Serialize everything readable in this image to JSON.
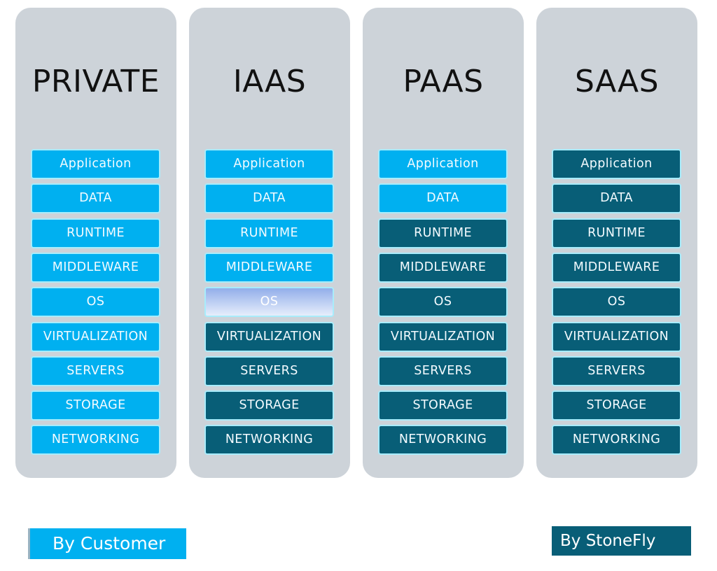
{
  "colors": {
    "customer": "#00b0f0",
    "stonefly": "#085e77",
    "shared": "#b7c8f2",
    "column_bg": "#cdd3d9"
  },
  "columns": [
    {
      "title": "PRIVATE",
      "layers": [
        {
          "label": "Application",
          "owner": "customer"
        },
        {
          "label": "DATA",
          "owner": "customer"
        },
        {
          "label": "RUNTIME",
          "owner": "customer"
        },
        {
          "label": "MIDDLEWARE",
          "owner": "customer"
        },
        {
          "label": "OS",
          "owner": "customer"
        },
        {
          "label": "VIRTUALIZATION",
          "owner": "customer"
        },
        {
          "label": "SERVERS",
          "owner": "customer"
        },
        {
          "label": "STORAGE",
          "owner": "customer"
        },
        {
          "label": "NETWORKING",
          "owner": "customer"
        }
      ]
    },
    {
      "title": "IAAS",
      "layers": [
        {
          "label": "Application",
          "owner": "customer"
        },
        {
          "label": "DATA",
          "owner": "customer"
        },
        {
          "label": "RUNTIME",
          "owner": "customer"
        },
        {
          "label": "MIDDLEWARE",
          "owner": "customer"
        },
        {
          "label": "OS",
          "owner": "shared"
        },
        {
          "label": "VIRTUALIZATION",
          "owner": "stonefly"
        },
        {
          "label": "SERVERS",
          "owner": "stonefly"
        },
        {
          "label": "STORAGE",
          "owner": "stonefly"
        },
        {
          "label": "NETWORKING",
          "owner": "stonefly"
        }
      ]
    },
    {
      "title": "PAAS",
      "layers": [
        {
          "label": "Application",
          "owner": "customer"
        },
        {
          "label": "DATA",
          "owner": "customer"
        },
        {
          "label": "RUNTIME",
          "owner": "stonefly"
        },
        {
          "label": "MIDDLEWARE",
          "owner": "stonefly"
        },
        {
          "label": "OS",
          "owner": "stonefly"
        },
        {
          "label": "VIRTUALIZATION",
          "owner": "stonefly"
        },
        {
          "label": "SERVERS",
          "owner": "stonefly"
        },
        {
          "label": "STORAGE",
          "owner": "stonefly"
        },
        {
          "label": "NETWORKING",
          "owner": "stonefly"
        }
      ]
    },
    {
      "title": "SAAS",
      "layers": [
        {
          "label": "Application",
          "owner": "stonefly"
        },
        {
          "label": "DATA",
          "owner": "stonefly"
        },
        {
          "label": "RUNTIME",
          "owner": "stonefly"
        },
        {
          "label": "MIDDLEWARE",
          "owner": "stonefly"
        },
        {
          "label": "OS",
          "owner": "stonefly"
        },
        {
          "label": "VIRTUALIZATION",
          "owner": "stonefly"
        },
        {
          "label": "SERVERS",
          "owner": "stonefly"
        },
        {
          "label": "STORAGE",
          "owner": "stonefly"
        },
        {
          "label": "NETWORKING",
          "owner": "stonefly"
        }
      ]
    }
  ],
  "legend": {
    "customer_label": "By Customer",
    "stonefly_label": "By StoneFly"
  }
}
